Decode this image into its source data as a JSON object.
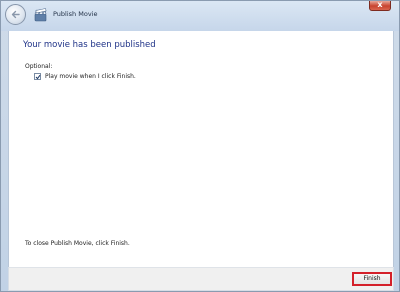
{
  "window": {
    "title": "Publish Movie"
  },
  "titlebar": {
    "close_glyph": "x"
  },
  "content": {
    "heading": "Your movie has been published",
    "optional_label": "Optional:",
    "checkbox_label": "Play movie when I click Finish.",
    "checkbox_checked": true,
    "footer_text": "To close Publish Movie, click Finish."
  },
  "footer": {
    "finish_label": "Finish"
  },
  "icons": {
    "back": "back-arrow-icon",
    "app": "movie-maker-icon",
    "close": "close-icon",
    "check": "checkmark-icon"
  },
  "colors": {
    "heading": "#1e3287",
    "finish_highlight": "#d4202a",
    "close_button": "#c8442f"
  }
}
